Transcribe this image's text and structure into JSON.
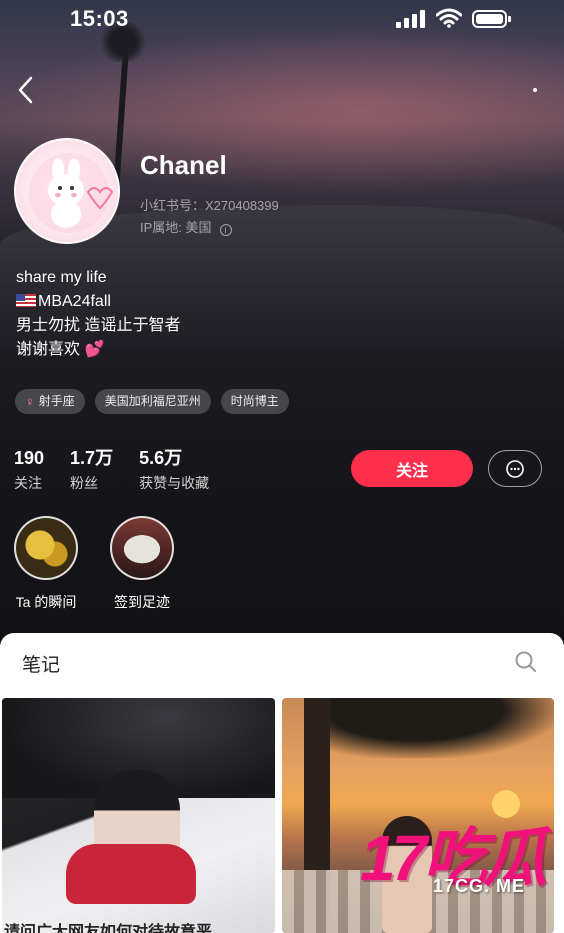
{
  "status_bar": {
    "time": "15:03"
  },
  "profile": {
    "name": "Chanel",
    "redbook_id": "小红书号：X270408399",
    "ip_location": "IP属地: 美国",
    "bio": [
      "share my life",
      "MBA24fall",
      "男士勿扰 造谣止于智者",
      "谢谢喜欢 💕"
    ],
    "tags": [
      "射手座",
      "美国加利福尼亚州",
      "时尚博主"
    ],
    "stats": [
      {
        "num": "190",
        "label": "关注"
      },
      {
        "num": "1.7万",
        "label": "粉丝"
      },
      {
        "num": "5.6万",
        "label": "获赞与收藏"
      }
    ],
    "follow_label": "关注",
    "highlights": [
      {
        "label": "Ta 的瞬间"
      },
      {
        "label": "签到足迹"
      }
    ]
  },
  "notes": {
    "title": "笔记",
    "first_caption": "请问广大网友如何对待故意恶"
  },
  "watermark": {
    "big": "17吃瓜",
    "small": "17CG. ME"
  },
  "colors": {
    "accent": "#ff2e4d",
    "watermark": "#f0127a"
  },
  "icons": [
    "back-icon",
    "signal-icon",
    "wifi-icon",
    "battery-icon",
    "info-icon",
    "venus-icon",
    "message-icon",
    "search-icon"
  ]
}
